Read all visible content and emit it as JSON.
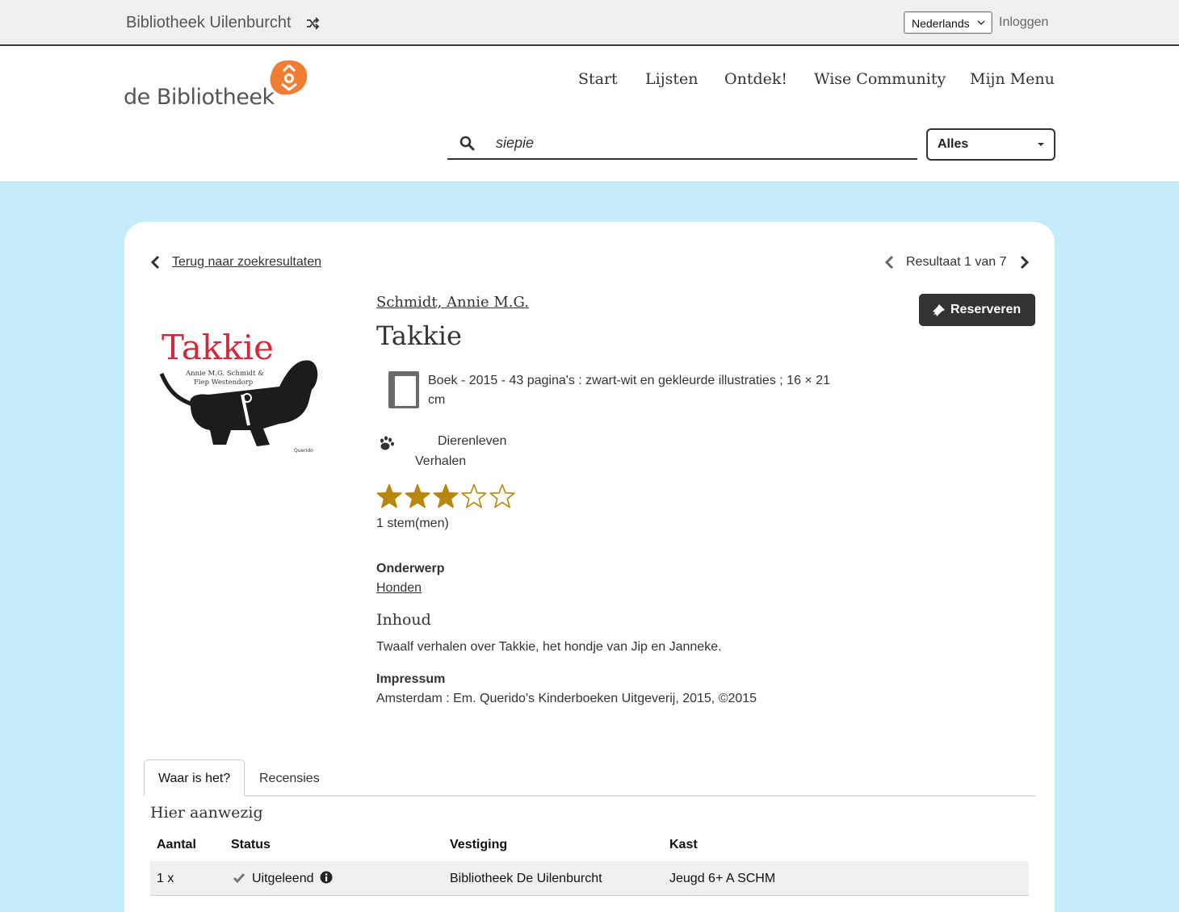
{
  "topbar": {
    "library_name": "Bibliotheek Uilenburcht",
    "language": "Nederlands",
    "login": "Inloggen"
  },
  "header": {
    "logo_text": "de Bibliotheek",
    "nav": [
      "Start",
      "Lijsten",
      "Ontdek!",
      "Wise Community",
      "Mijn Menu"
    ],
    "search_query": "siepie",
    "search_scope": "Alles"
  },
  "detail": {
    "back_label": "Terug naar zoekresultaten",
    "result_label": "Resultaat 1 van 7",
    "cover": {
      "title": "Takkie",
      "authors_line1": "Annie M.G. Schmidt &",
      "authors_line2": "Fiep Westendorp",
      "publisher": "Querido"
    },
    "author": "Schmidt, Annie M.G.",
    "title": "Takkie",
    "reserve_label": "Reserveren",
    "format": "Boek - 2015 - 43 pagina's : zwart-wit en gekleurde illustraties ; 16 × 21 cm",
    "genres": [
      "Dierenleven",
      "Verhalen"
    ],
    "rating": {
      "value": 3,
      "max": 5
    },
    "votes": "1 stem(men)",
    "subject_label": "Onderwerp",
    "subject": "Honden",
    "content_heading": "Inhoud",
    "content_text": "Twaalf verhalen over Takkie, het hondje van Jip en Janneke.",
    "impressum_label": "Impressum",
    "impressum": "Amsterdam : Em. Querido's Kinderboeken Uitgeverij, 2015, ©2015"
  },
  "tabs": [
    "Waar is het?",
    "Recensies"
  ],
  "availability": {
    "heading": "Hier aanwezig",
    "columns": [
      "Aantal",
      "Status",
      "Vestiging",
      "Kast"
    ],
    "rows": [
      {
        "count": "1 x",
        "status": "Uitgeleend",
        "branch": "Bibliotheek De Uilenburcht",
        "shelf": "Jeugd 6+ A SCHM"
      }
    ]
  },
  "colors": {
    "page_bg": "#c4ecfb",
    "brand_orange": "#f07d32",
    "star_gold": "#b8860b",
    "dark_button": "#333333"
  }
}
